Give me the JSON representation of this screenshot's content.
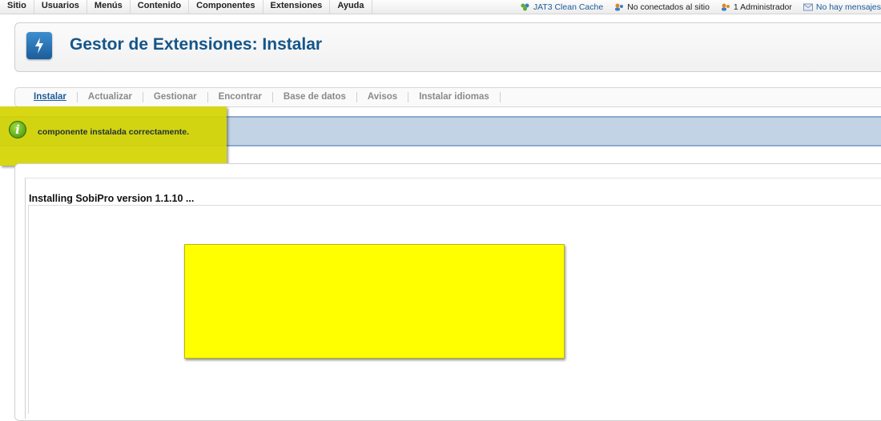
{
  "topmenu": {
    "items": [
      "Sitio",
      "Usuarios",
      "Menús",
      "Contenido",
      "Componentes",
      "Extensiones",
      "Ayuda"
    ]
  },
  "status": {
    "cache": "JAT3 Clean Cache",
    "visitors": "No conectados al sitio",
    "admins": "1 Administrador",
    "messages": "No hay mensajes"
  },
  "header": {
    "title": "Gestor de Extensiones: Instalar"
  },
  "submenu": {
    "tabs": [
      "Instalar",
      "Actualizar",
      "Gestionar",
      "Encontrar",
      "Base de datos",
      "Avisos",
      "Instalar idiomas"
    ],
    "active": "Instalar"
  },
  "message": {
    "text": "componente instalada correctamente."
  },
  "content": {
    "install_title": "Installing SobiPro version 1.1.10 ..."
  },
  "colors": {
    "accent": "#14568a",
    "message_bg": "#c3d3e6",
    "highlight": "#d4d400",
    "redaction": "#ffff00"
  }
}
